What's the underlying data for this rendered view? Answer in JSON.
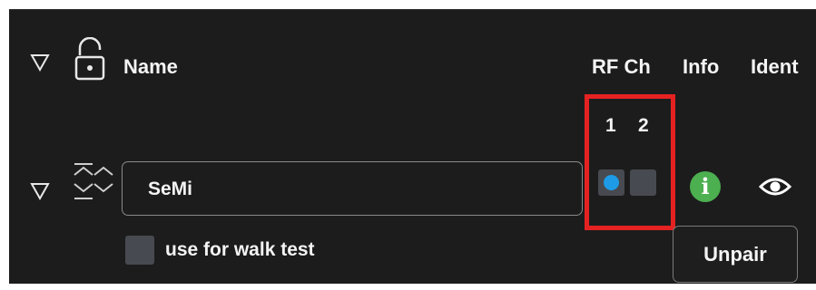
{
  "header": {
    "name_label": "Name",
    "rf_ch_label": "RF Ch",
    "info_label": "Info",
    "ident_label": "Ident"
  },
  "channels": [
    "1",
    "2"
  ],
  "device": {
    "name": "SeMi",
    "rf_channels": [
      {
        "channel": "1",
        "active": true,
        "color": "#1e9be6"
      },
      {
        "channel": "2",
        "active": false
      }
    ],
    "info_icon": "info-icon",
    "info_color": "#4caf50",
    "ident_icon": "eye-icon",
    "walk_test_label": "use for walk test",
    "walk_test_checked": false,
    "unpair_label": "Unpair"
  },
  "icons": {
    "collapse": "triangle-down-icon",
    "lock": "unlocked-padlock-icon",
    "sort": "expand-collapse-icon"
  },
  "colors": {
    "background": "#1c1c1c",
    "highlight": "#e52222",
    "rf_active": "#1e9be6",
    "info": "#4caf50"
  }
}
